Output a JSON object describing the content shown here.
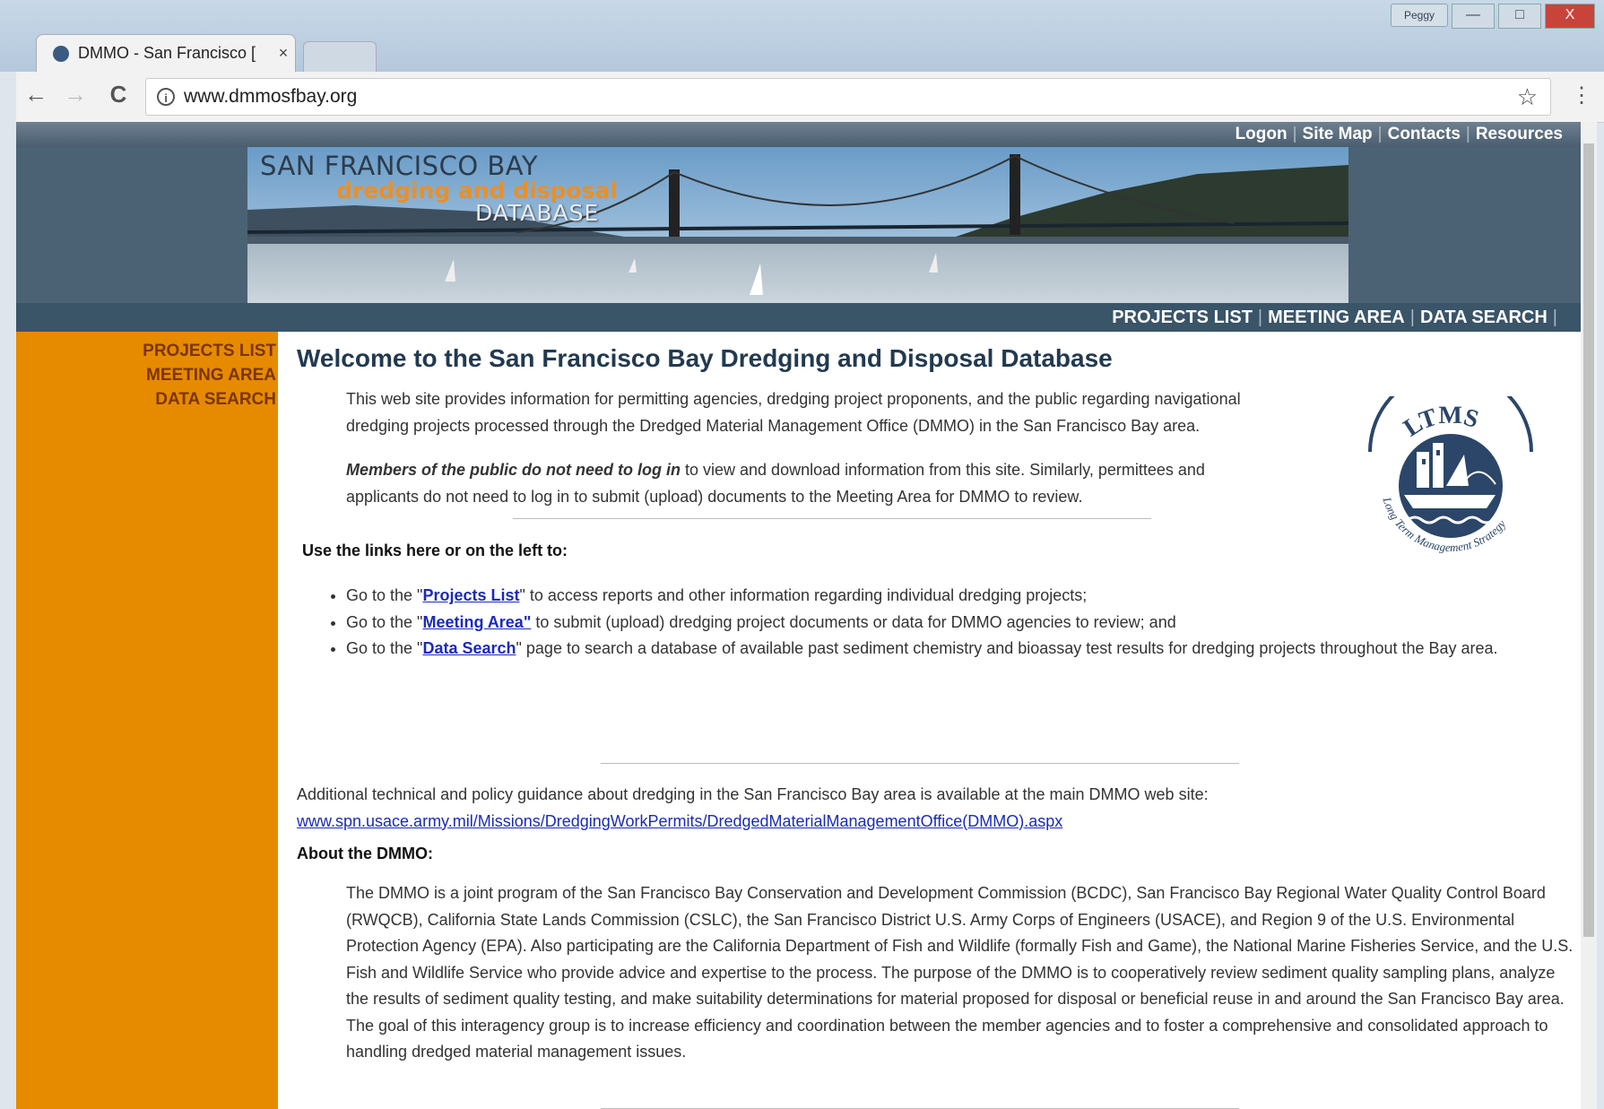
{
  "browser": {
    "tab_title": "DMMO - San Francisco [",
    "tab_close": "×",
    "user_badge": "Peggy",
    "min": "—",
    "max": "□",
    "close": "X",
    "back": "←",
    "forward": "→",
    "reload": "C",
    "info": "i",
    "url": "www.dmmosfbay.org",
    "star": "☆",
    "menu": "⋮"
  },
  "header": {
    "top_links": [
      "Logon",
      "Site Map",
      "Contacts",
      "Resources"
    ],
    "banner": {
      "line1": "SAN FRANCISCO BAY",
      "line2": "dredging and disposal",
      "line3": "DATABASE"
    },
    "section_links": [
      "PROJECTS LIST",
      "MEETING AREA",
      "DATA SEARCH"
    ]
  },
  "sidebar": {
    "links": [
      "PROJECTS LIST",
      "MEETING AREA",
      "DATA SEARCH"
    ]
  },
  "main": {
    "title": "Welcome to the San Francisco Bay Dredging and Disposal Database",
    "intro1": "This web site provides information for permitting agencies, dredging project proponents, and the public regarding navigational dredging projects processed through the Dredged Material Management Office (DMMO) in the San Francisco Bay area.",
    "intro2_bold": "Members of the public do not need to log in",
    "intro2_rest": " to view and download information from this site. Similarly, permittees and applicants do not need to log in to submit (upload) documents to the Meeting Area for DMMO to review.",
    "links_heading": "Use the links here or on the left to:",
    "bullets": [
      {
        "pre": "Go to the \"",
        "link": "Projects List",
        "post": "\" to access reports and other information regarding individual dredging projects;"
      },
      {
        "pre": "Go to the \"",
        "link": "Meeting Area\"",
        "post": " to submit (upload) dredging project documents or data for DMMO agencies to review; and"
      },
      {
        "pre": "Go to the \"",
        "link": "Data Search",
        "post": "\" page to search a database of available past sediment chemistry and bioassay test results for dredging projects throughout the Bay area."
      }
    ],
    "additional": "Additional technical and policy guidance about dredging in the San Francisco Bay area is available at the main DMMO web site:",
    "additional_link": "www.spn.usace.army.mil/Missions/DredgingWorkPermits/DredgedMaterialManagementOffice(DMMO).aspx",
    "about_heading": "About the DMMO:",
    "about_text": "The DMMO is a joint program of the San Francisco Bay Conservation and Development Commission (BCDC), San Francisco Bay Regional Water Quality Control Board (RWQCB), California State Lands Commission (CSLC), the San Francisco District U.S. Army Corps of Engineers (USACE), and Region 9 of the U.S. Environmental Protection  Agency  (EPA).   Also participating are the California Department of Fish and Wildlife (formally Fish and Game), the National Marine Fisheries Service, and the U.S. Fish and Wildlife Service who provide advice and expertise to the process.  The purpose of the DMMO is to cooperatively review sediment quality sampling plans, analyze the results of sediment quality testing, and make suitability determinations for material proposed for disposal or beneficial reuse in and around the San Francisco Bay area.  The goal of  this interagency group is to increase efficiency and coordination between the member agencies and to foster a comprehensive and consolidated approach to handling dredged material management issues."
  },
  "logo": {
    "top": "LTMS",
    "bottom": "Long Term Management Strategy"
  },
  "colors": {
    "sidebar": "#e68a00",
    "navy": "#2b4668",
    "link": "#1a2bb8"
  }
}
